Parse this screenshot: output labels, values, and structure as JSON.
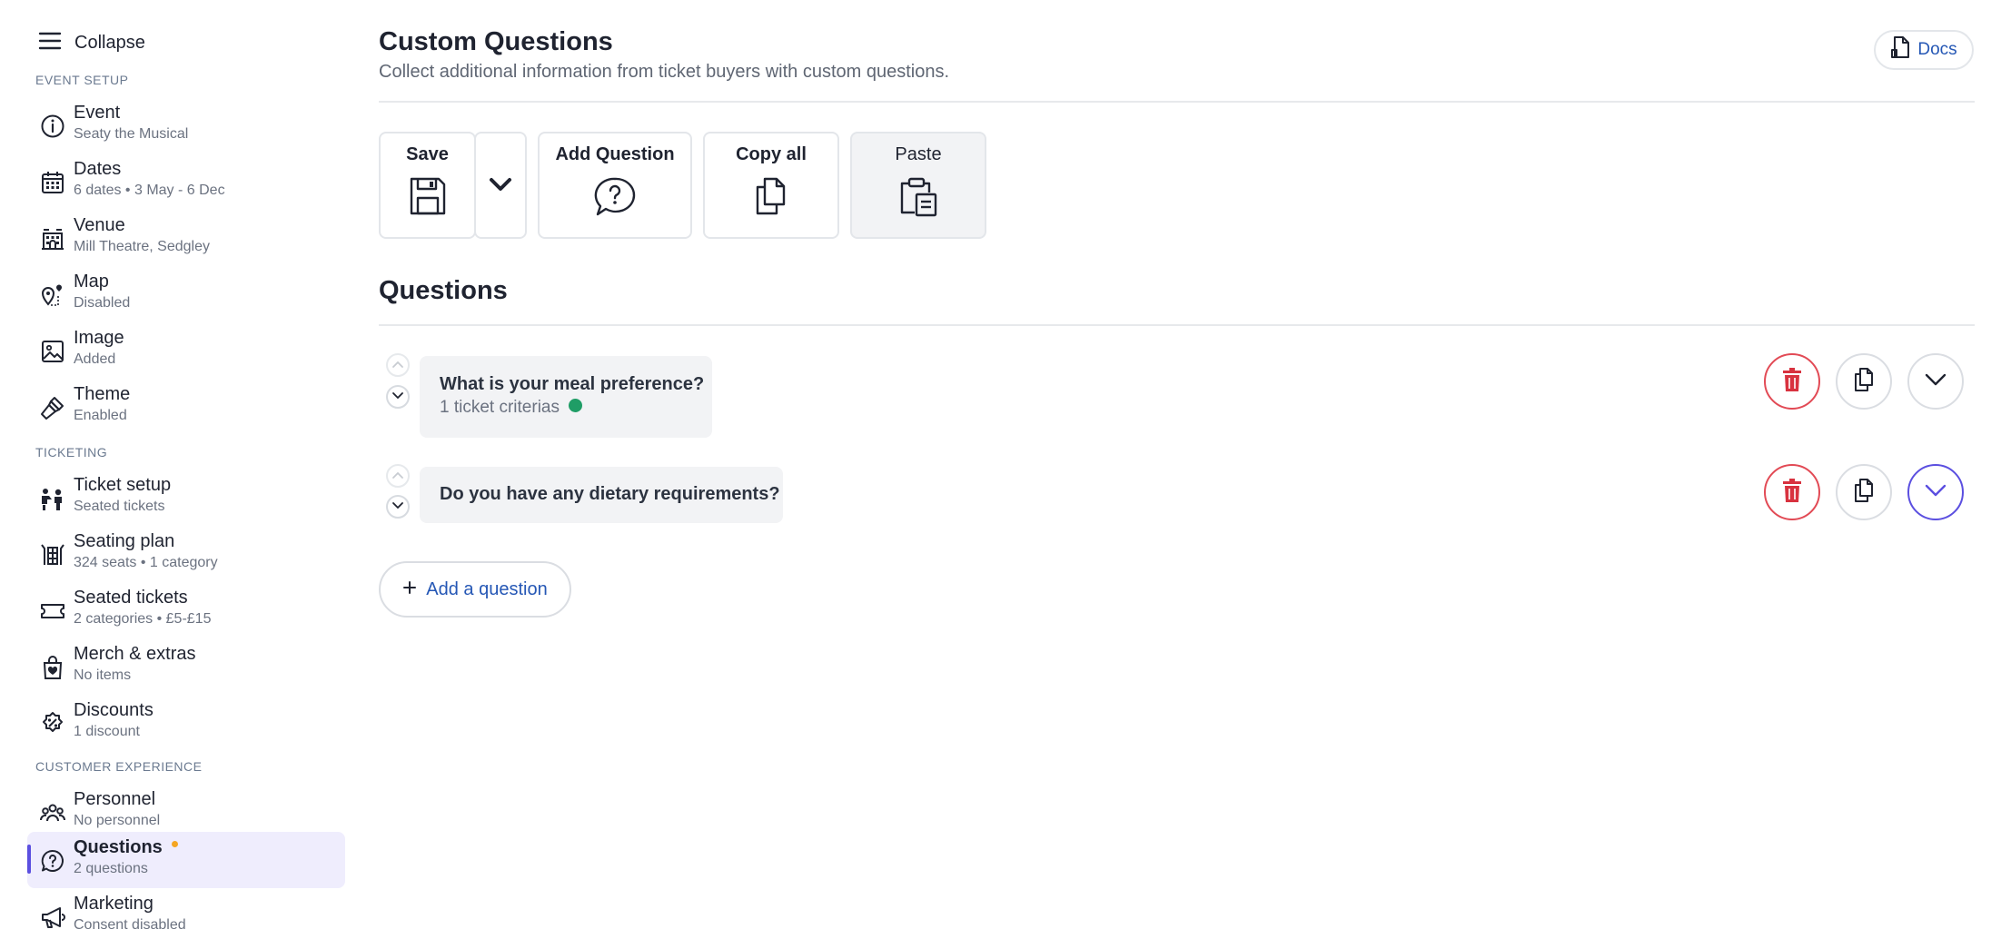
{
  "sidebar": {
    "collapse_label": "Collapse",
    "sections": {
      "event_setup": "EVENT SETUP",
      "ticketing": "TICKETING",
      "customer_experience": "CUSTOMER EXPERIENCE"
    },
    "items": [
      {
        "title": "Event",
        "sub": "Seaty the Musical",
        "icon": "info-icon"
      },
      {
        "title": "Dates",
        "sub": "6 dates • 3 May - 6 Dec",
        "icon": "calendar-icon"
      },
      {
        "title": "Venue",
        "sub": "Mill Theatre, Sedgley",
        "icon": "building-icon"
      },
      {
        "title": "Map",
        "sub": "Disabled",
        "icon": "map-pin-icon"
      },
      {
        "title": "Image",
        "sub": "Added",
        "icon": "image-icon"
      },
      {
        "title": "Theme",
        "sub": "Enabled",
        "icon": "paintbrush-icon"
      },
      {
        "title": "Ticket setup",
        "sub": "Seated tickets",
        "icon": "ticket-setup-icon"
      },
      {
        "title": "Seating plan",
        "sub": "324 seats • 1 category",
        "icon": "seating-plan-icon"
      },
      {
        "title": "Seated tickets",
        "sub": "2 categories • £5-£15",
        "icon": "ticket-icon"
      },
      {
        "title": "Merch & extras",
        "sub": "No items",
        "icon": "shopping-bag-icon"
      },
      {
        "title": "Discounts",
        "sub": "1 discount",
        "icon": "discount-badge-icon"
      },
      {
        "title": "Personnel",
        "sub": "No personnel",
        "icon": "people-icon"
      },
      {
        "title": "Questions",
        "sub": "2 questions",
        "icon": "question-bubble-icon",
        "active": true
      },
      {
        "title": "Marketing",
        "sub": "Consent disabled",
        "icon": "megaphone-icon"
      }
    ]
  },
  "header": {
    "title": "Custom Questions",
    "subtitle": "Collect additional information from ticket buyers with custom questions.",
    "docs_label": "Docs"
  },
  "toolbar": {
    "save_label": "Save",
    "add_question_label": "Add Question",
    "copy_all_label": "Copy all",
    "paste_label": "Paste"
  },
  "questions_section": {
    "title": "Questions",
    "items": [
      {
        "text": "What is your meal preference?",
        "criteria": "1 ticket criterias"
      },
      {
        "text": "Do you have any dietary requirements?",
        "criteria": ""
      }
    ],
    "add_label": "Add a question"
  },
  "colors": {
    "accent": "#5b4fe0",
    "delete": "#e24a55",
    "link": "#2557b5",
    "status_green": "#1f9d66",
    "status_orange": "#f5a623"
  }
}
